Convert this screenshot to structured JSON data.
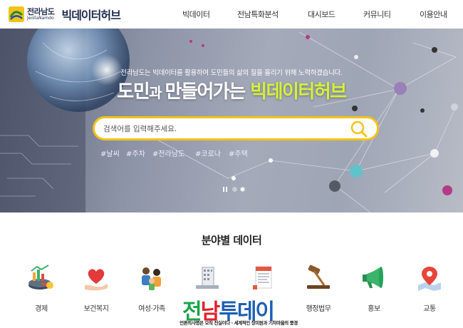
{
  "header": {
    "logo_korean": "전라남도",
    "logo_english": "JeollaNamdo",
    "site_title": "빅데이터허브",
    "nav": [
      "빅데이터",
      "전남특화분석",
      "대시보드",
      "커뮤니티",
      "이용안내"
    ]
  },
  "hero": {
    "subtitle": "전라남도는 빅데이터를 활용하여 도민들의 삶의 질을 올리기 위해 노력하겠습니다.",
    "title_part1": "도민",
    "title_part2": "과 ",
    "title_part3": "만들어가는 ",
    "title_part4": "빅데이터허브",
    "search_placeholder": "검색어를 입력해주세요.",
    "tags": [
      "#날씨",
      "#주차",
      "#전라남도",
      "#코로나",
      "#주택"
    ],
    "slides": {
      "total": 2,
      "active": 2
    }
  },
  "section": {
    "title": "분야별 데이터",
    "categories": [
      {
        "label": "경제",
        "icon": "economy-coins-icon"
      },
      {
        "label": "보건복지",
        "icon": "heart-hand-icon"
      },
      {
        "label": "여성·가족",
        "icon": "family-icon"
      },
      {
        "label": "",
        "icon": "building-icon"
      },
      {
        "label": "",
        "icon": "document-icon"
      },
      {
        "label": "행정법무",
        "icon": "gavel-icon"
      },
      {
        "label": "홍보",
        "icon": "megaphone-icon"
      },
      {
        "label": "교통",
        "icon": "map-pin-icon"
      }
    ]
  },
  "watermark": {
    "brand_part1": "전",
    "brand_part2": "남",
    "brand_part3": "투데이",
    "tagline": "언론의사명은 오직 진실이다 · 세계적인 장미원과 기차마을의 풍경"
  },
  "colors": {
    "accent_yellow": "#f3c318",
    "title_green": "#d4f13a",
    "nav_dark": "#1c2b4f"
  }
}
